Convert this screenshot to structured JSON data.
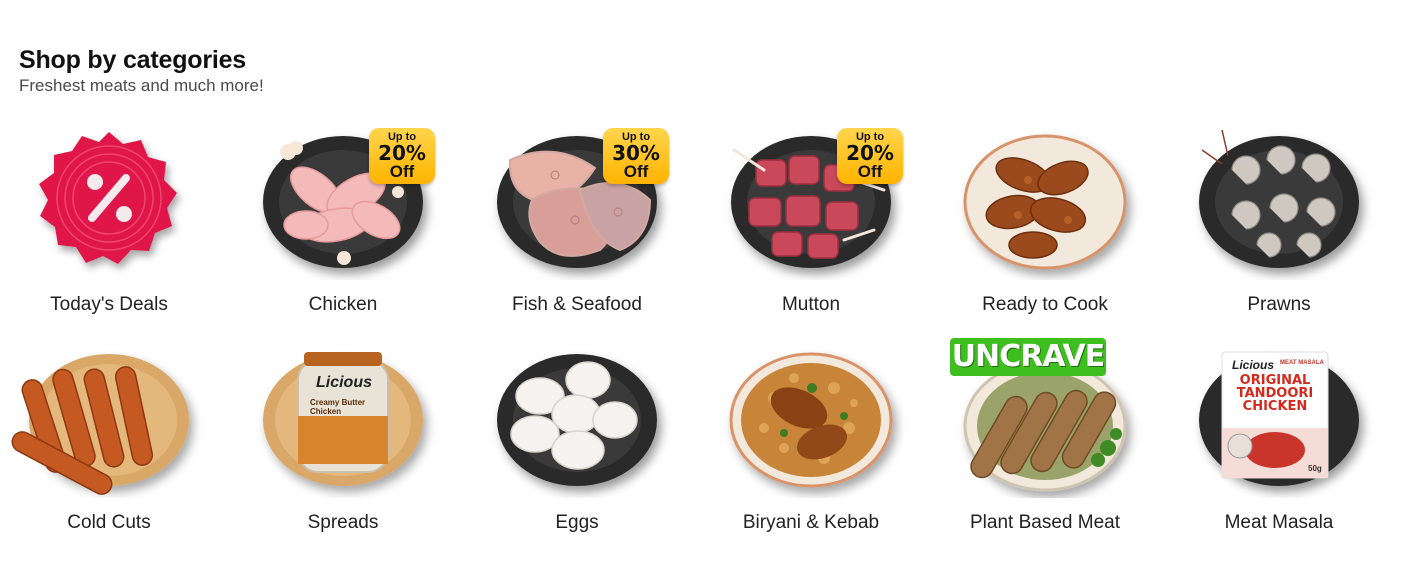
{
  "section": {
    "title": "Shop by categories",
    "subtitle": "Freshest meats and much more!"
  },
  "categories": [
    {
      "label": "Today's Deals",
      "icon": "percent-badge-icon"
    },
    {
      "label": "Chicken",
      "badge": {
        "line1": "Up to",
        "line2": "20%",
        "line3": "Off"
      }
    },
    {
      "label": "Fish & Seafood",
      "badge": {
        "line1": "Up to",
        "line2": "30%",
        "line3": "Off"
      }
    },
    {
      "label": "Mutton",
      "badge": {
        "line1": "Up to",
        "line2": "20%",
        "line3": "Off"
      }
    },
    {
      "label": "Ready to Cook"
    },
    {
      "label": "Prawns"
    },
    {
      "label": "Cold Cuts"
    },
    {
      "label": "Spreads",
      "jar_brand": "Licious",
      "jar_text": "Creamy Butter Chicken"
    },
    {
      "label": "Eggs"
    },
    {
      "label": "Biryani & Kebab"
    },
    {
      "label": "Plant Based Meat",
      "brand_banner": "UNCRAVE"
    },
    {
      "label": "Meat Masala",
      "pack_brand": "Licious",
      "pack_tag": "MEAT MASALA",
      "pack_title": "ORIGINAL TANDOORI CHICKEN",
      "pack_weight": "50g"
    }
  ],
  "colors": {
    "deal_red": "#e0194a",
    "badge_gold": "#ffc21a",
    "plate_dark": "#2b2b2b",
    "plate_wood": "#d9a868",
    "uncrave_green": "#3fbf1f"
  }
}
